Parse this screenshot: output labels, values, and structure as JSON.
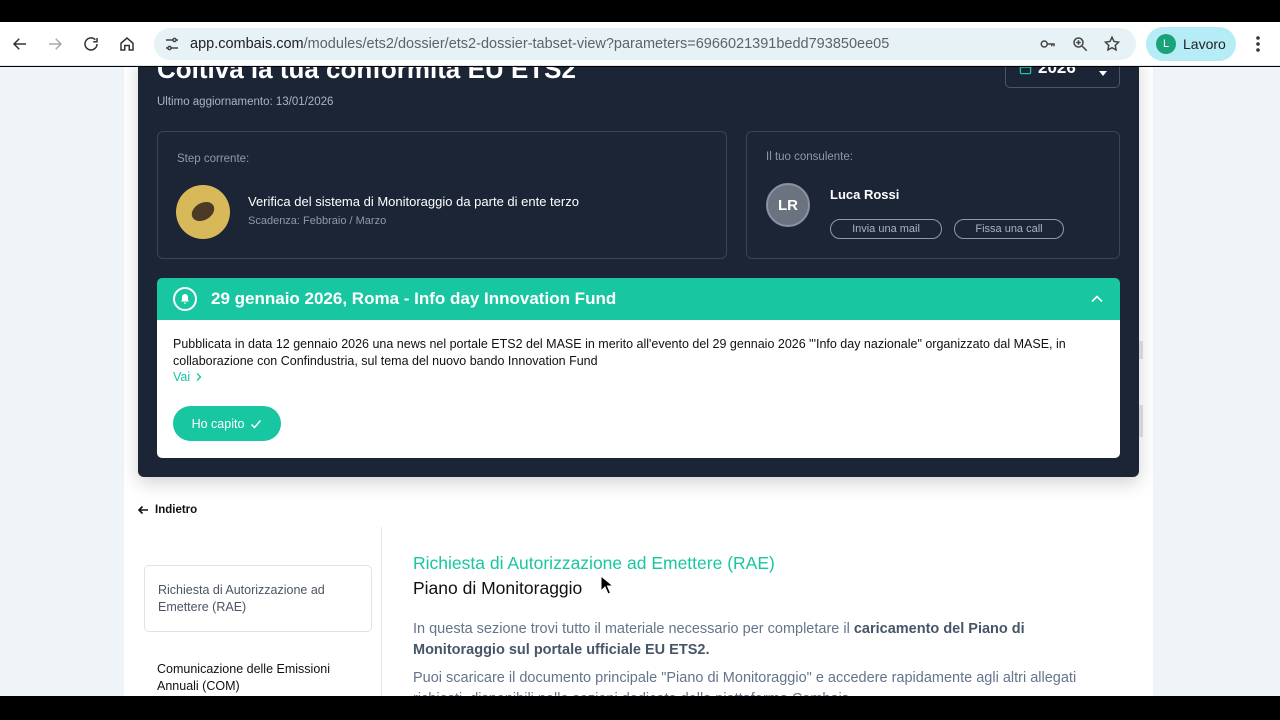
{
  "browser": {
    "url_host": "app.combais.com",
    "url_path": "/modules/ets2/dossier/ets2-dossier-tabset-view?parameters=6966021391bedd793850ee05",
    "profile_initial": "L",
    "profile_name": "Lavoro"
  },
  "header": {
    "title": "Coltiva la tua conformità EU ETS2",
    "updated": "Ultimo aggiornamento: 13/01/2026",
    "year": "2026"
  },
  "step": {
    "label": "Step corrente:",
    "title": "Verifica del sistema di Monitoraggio da parte di ente terzo",
    "deadline": "Scadenza: Febbraio / Marzo"
  },
  "consultant": {
    "label": "Il tuo consulente:",
    "initials": "LR",
    "name": "Luca Rossi",
    "mail_label": "Invia una mail",
    "call_label": "Fissa una call"
  },
  "notice": {
    "title": "29 gennaio 2026, Roma - Info day Innovation Fund",
    "text": "Pubblicata in data 12 gennaio 2026 una news nel portale ETS2 del MASE in merito all'evento del 29 gennaio 2026 \"'Info day nazionale\" organizzato dal MASE, in collaborazione con Confindustria, sul tema del nuovo bando Innovation Fund",
    "link_label": "Vai",
    "ok_label": "Ho capito"
  },
  "nav": {
    "back_label": "Indietro",
    "sidebar": [
      "Richiesta di Autorizzazione ad Emettere (RAE)",
      "Comunicazione delle Emissioni Annuali (COM)"
    ]
  },
  "content": {
    "overline": "Richiesta di Autorizzazione ad Emettere (RAE)",
    "title": "Piano di Monitoraggio",
    "p1_pre": "In questa sezione trovi tutto il materiale necessario per completare il ",
    "p1_bold": "caricamento del Piano di Monitoraggio sul portale ufficiale EU ETS2.",
    "p2": "Puoi scaricare il documento principale \"Piano di Monitoraggio\" e accedere rapidamente agli altri allegati richiesti, disponibili nelle sezioni dedicate della piattaforma Combais."
  },
  "colors": {
    "accent": "#18c6a2",
    "dark_card": "#1c2536"
  }
}
